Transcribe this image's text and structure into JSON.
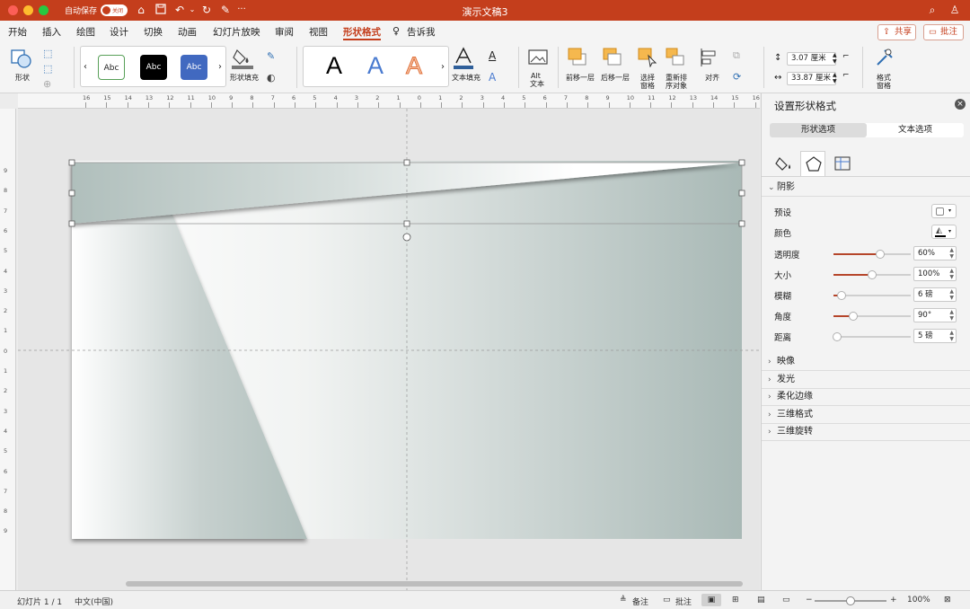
{
  "titlebar": {
    "autosave_label": "自动保存",
    "autosave_state": "关闭",
    "doc_title": "演示文稿3"
  },
  "tabs": [
    "开始",
    "插入",
    "绘图",
    "设计",
    "切换",
    "动画",
    "幻灯片放映",
    "审阅",
    "视图",
    "形状格式",
    "告诉我"
  ],
  "active_tab": "形状格式",
  "header_buttons": {
    "share": "共享",
    "comment": "批注"
  },
  "ribbon": {
    "shapes_label": "形状",
    "style_swatches": [
      "Abc",
      "Abc",
      "Abc"
    ],
    "shape_fill_label": "形状填充",
    "wordart_letters": [
      "A",
      "A",
      "A"
    ],
    "text_fill_label": "文本填充",
    "alt_text_label_1": "Alt",
    "alt_text_label_2": "文本",
    "bring_forward": "前移一层",
    "send_backward": "后移一层",
    "selection_pane_1": "选择",
    "selection_pane_2": "窗格",
    "reorder_1": "重新排",
    "reorder_2": "序对象",
    "align": "对齐",
    "height_value": "3.07 厘米",
    "width_value": "33.87 厘米",
    "format_pane_1": "格式",
    "format_pane_2": "窗格"
  },
  "ruler": {
    "h_ticks": [
      "16",
      "15",
      "14",
      "13",
      "12",
      "11",
      "10",
      "9",
      "8",
      "7",
      "6",
      "5",
      "4",
      "3",
      "2",
      "1",
      "0",
      "1",
      "2",
      "3",
      "4",
      "5",
      "6",
      "7",
      "8",
      "9",
      "10",
      "11",
      "12",
      "13",
      "14",
      "15",
      "16"
    ],
    "v_ticks": [
      "9",
      "8",
      "7",
      "6",
      "5",
      "4",
      "3",
      "2",
      "1",
      "0",
      "1",
      "2",
      "3",
      "4",
      "5",
      "6",
      "7",
      "8",
      "9"
    ]
  },
  "pane": {
    "title": "设置形状格式",
    "seg_shape": "形状选项",
    "seg_text": "文本选项",
    "shadow_section": "阴影",
    "preset_label": "预设",
    "color_label": "颜色",
    "props": [
      {
        "label": "透明度",
        "value": "60%",
        "level": 0.6
      },
      {
        "label": "大小",
        "value": "100%",
        "level": 0.5
      },
      {
        "label": "模糊",
        "value": "6 磅",
        "level": 0.1
      },
      {
        "label": "角度",
        "value": "90°",
        "level": 0.25
      },
      {
        "label": "距离",
        "value": "5 磅",
        "level": 0.05
      }
    ],
    "collapsed_sections": [
      "映像",
      "发光",
      "柔化边缘",
      "三维格式",
      "三维旋转"
    ]
  },
  "status": {
    "slide": "幻灯片 1 / 1",
    "language": "中文(中国)",
    "notes": "备注",
    "comments": "批注",
    "zoom": "100%"
  },
  "colors": {
    "accent": "#c43e1c",
    "slider_fill": "#b5452a"
  }
}
